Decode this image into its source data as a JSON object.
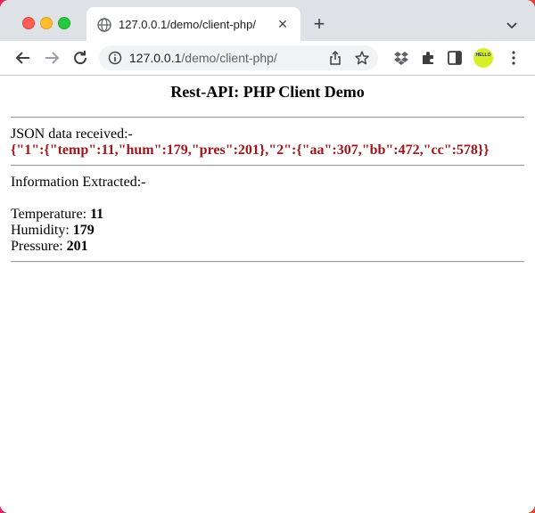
{
  "browser": {
    "tab_title": "127.0.0.1/demo/client-php/",
    "url_host": "127.0.0.1",
    "url_path": "/demo/client-php/",
    "avatar_text": "HELLO",
    "colors": {
      "tabstrip": "#dee1e6",
      "json_text": "#a0161b"
    }
  },
  "page": {
    "title": "Rest-API: PHP Client Demo",
    "json_label": "JSON data received:-",
    "json_text": "{\"1\":{\"temp\":11,\"hum\":179,\"pres\":201},\"2\":{\"aa\":307,\"bb\":472,\"cc\":578}}",
    "info_label": "Information Extracted:-",
    "fields": [
      {
        "label": "Temperature: ",
        "value": "11"
      },
      {
        "label": "Humidity: ",
        "value": "179"
      },
      {
        "label": "Pressure: ",
        "value": "201"
      }
    ]
  }
}
